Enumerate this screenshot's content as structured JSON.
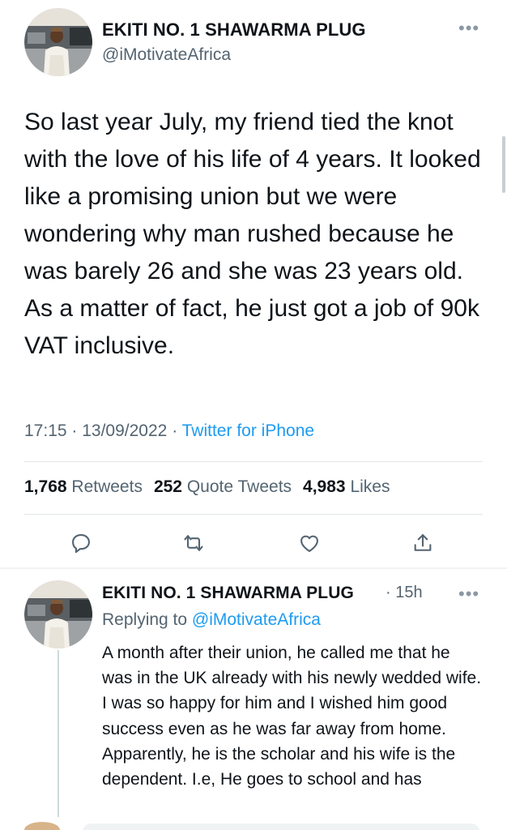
{
  "main_tweet": {
    "author_name": "EKITI NO. 1 SHAWARMA PLUG",
    "author_handle": "@iMotivateAfrica",
    "more_icon": "ellipsis-icon",
    "text": "So last year July, my friend tied the knot with the love of his life of 4 years. It looked like a promising union but we were wondering why man rushed because he was barely 26 and she was 23 years old. As a matter of fact, he just got a job of 90k VAT inclusive.",
    "time": "17:15",
    "date": "13/09/2022",
    "source": "Twitter for iPhone",
    "retweets_count": "1,768",
    "retweets_label": "Retweets",
    "quotes_count": "252",
    "quotes_label": "Quote Tweets",
    "likes_count": "4,983",
    "likes_label": "Likes",
    "actions": [
      "reply-icon",
      "retweet-icon",
      "like-icon",
      "share-icon"
    ]
  },
  "reply_tweet": {
    "author_name": "EKITI NO. 1 SHAWARMA PLUG",
    "time": "15h",
    "replying_prefix": "Replying to",
    "replying_to": "@iMotivateAfrica",
    "text": "A month after their union, he called me that he was in the UK already with his newly wedded wife. I was so happy for him and I wished him good success even as he was far away from home. Apparently, he is the scholar and his wife is the dependent. I.e, He goes to school and has"
  },
  "colors": {
    "text": "#0f1419",
    "secondary": "#536471",
    "accent": "#1d9bf0",
    "divider": "#e1e6ea"
  }
}
